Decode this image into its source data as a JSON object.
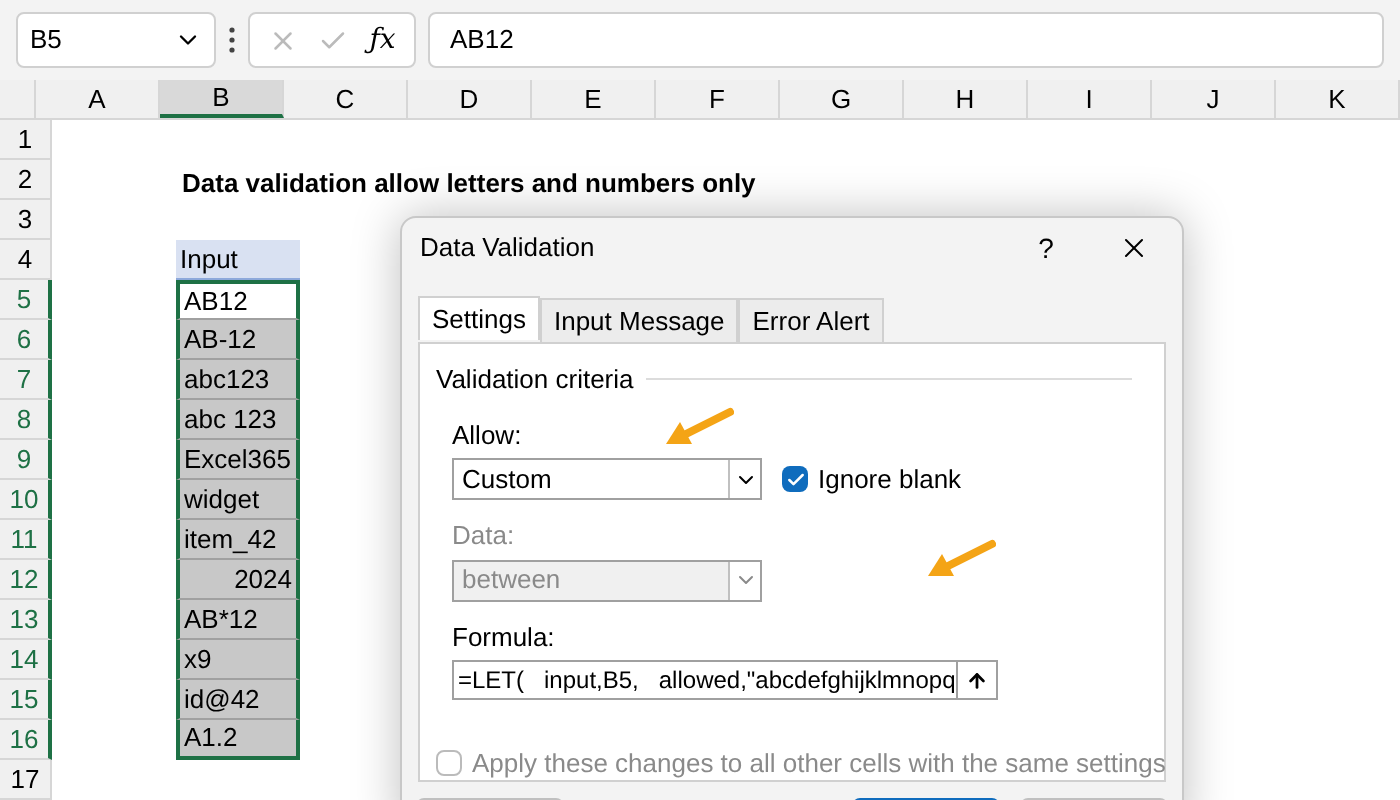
{
  "formula_bar": {
    "name_box": "B5",
    "function_label": "ƒx",
    "formula": "AB12"
  },
  "columns": [
    {
      "label": "A",
      "selected": false
    },
    {
      "label": "B",
      "selected": true
    },
    {
      "label": "C",
      "selected": false
    },
    {
      "label": "D",
      "selected": false
    },
    {
      "label": "E",
      "selected": false
    },
    {
      "label": "F",
      "selected": false
    },
    {
      "label": "G",
      "selected": false
    },
    {
      "label": "H",
      "selected": false
    },
    {
      "label": "I",
      "selected": false
    },
    {
      "label": "J",
      "selected": false
    },
    {
      "label": "K",
      "selected": false
    }
  ],
  "rows": [
    {
      "label": "1",
      "selected": false
    },
    {
      "label": "2",
      "selected": false
    },
    {
      "label": "3",
      "selected": false
    },
    {
      "label": "4",
      "selected": false
    },
    {
      "label": "5",
      "selected": true
    },
    {
      "label": "6",
      "selected": true
    },
    {
      "label": "7",
      "selected": true
    },
    {
      "label": "8",
      "selected": true
    },
    {
      "label": "9",
      "selected": true
    },
    {
      "label": "10",
      "selected": true
    },
    {
      "label": "11",
      "selected": true
    },
    {
      "label": "12",
      "selected": true
    },
    {
      "label": "13",
      "selected": true
    },
    {
      "label": "14",
      "selected": true
    },
    {
      "label": "15",
      "selected": true
    },
    {
      "label": "16",
      "selected": true
    },
    {
      "label": "17",
      "selected": false
    }
  ],
  "sheet_title": "Data validation allow letters and numbers only",
  "table": {
    "header": "Input",
    "cells": [
      {
        "value": "AB12",
        "kind": "text",
        "active": true
      },
      {
        "value": "AB-12",
        "kind": "text",
        "active": false
      },
      {
        "value": "abc123",
        "kind": "text",
        "active": false
      },
      {
        "value": "abc 123",
        "kind": "text",
        "active": false
      },
      {
        "value": "Excel365",
        "kind": "text",
        "active": false
      },
      {
        "value": "widget",
        "kind": "text",
        "active": false
      },
      {
        "value": "item_42",
        "kind": "text",
        "active": false
      },
      {
        "value": "2024",
        "kind": "number",
        "active": false
      },
      {
        "value": "AB*12",
        "kind": "text",
        "active": false
      },
      {
        "value": "x9",
        "kind": "text",
        "active": false
      },
      {
        "value": "id@42",
        "kind": "text",
        "active": false
      },
      {
        "value": "A1.2",
        "kind": "text",
        "active": false
      }
    ]
  },
  "dialog": {
    "title": "Data Validation",
    "help": "?",
    "tabs": [
      {
        "label": "Settings",
        "selected": true
      },
      {
        "label": "Input Message",
        "selected": false
      },
      {
        "label": "Error Alert",
        "selected": false
      }
    ],
    "section": "Validation criteria",
    "allow": {
      "label": "Allow:",
      "value": "Custom"
    },
    "ignore_blank": {
      "label": "Ignore blank",
      "checked": true
    },
    "data": {
      "label": "Data:",
      "value": "between",
      "disabled": true
    },
    "formula": {
      "label": "Formula:",
      "value": "=LET(   input,B5,   allowed,\"abcdefghijklmnopq"
    },
    "apply_all": {
      "label": "Apply these changes to all other cells with the same settings",
      "checked": false,
      "disabled": true
    }
  }
}
